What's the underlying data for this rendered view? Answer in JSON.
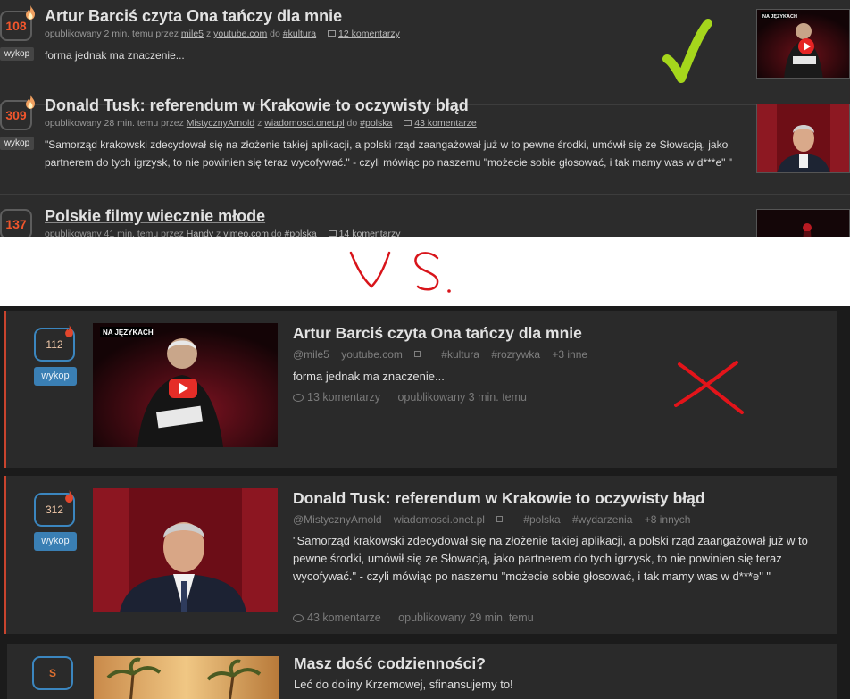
{
  "old": {
    "items": [
      {
        "votes": "108",
        "dig_label": "wykop",
        "title": "Artur Barciś czyta Ona tańczy dla mnie",
        "meta_prefix": "opublikowany 2 min. temu przez",
        "author": "mile5",
        "source_prefix": "z",
        "source": "youtube.com",
        "tag_prefix": "do",
        "tag": "#kultura",
        "comments": "12 komentarzy",
        "description": "forma jednak ma znaczenie...",
        "thumb_caption": "NA JĘZYKACH"
      },
      {
        "votes": "309",
        "dig_label": "wykop",
        "title": "Donald Tusk: referendum w Krakowie to oczywisty błąd",
        "meta_prefix": "opublikowany 28 min. temu przez",
        "author": "MistycznyArnold",
        "source_prefix": "z",
        "source": "wiadomosci.onet.pl",
        "tag_prefix": "do",
        "tag": "#polska",
        "comments": "43 komentarze",
        "description": "\"Samorząd krakowski zdecydował się na złożenie takiej aplikacji, a polski rząd zaangażował już w to pewne środki, umówił się ze Słowacją, jako partnerem do tych igrzysk, to nie powinien się teraz wycofywać.\" - czyli mówiąc po naszemu \"możecie sobie głosować, i tak mamy was w d***e\" \""
      },
      {
        "votes": "137",
        "title": "Polskie filmy wiecznie młode",
        "meta_prefix": "opublikowany 41 min. temu przez",
        "author": "Handy",
        "source_prefix": "z",
        "source": "vimeo.com",
        "tag_prefix": "do",
        "tag": "#polska",
        "comments": "14 komentarzy"
      }
    ]
  },
  "annotations": {
    "vs_label": "V S.",
    "check_color": "#a5d61c",
    "cross_color": "#e3141a",
    "vs_color": "#d8141a"
  },
  "new": {
    "items": [
      {
        "votes": "112",
        "dig_label": "wykop",
        "title": "Artur Barciś czyta Ona tańczy dla mnie",
        "author": "@mile5",
        "source": "youtube.com",
        "tags": [
          "#kultura",
          "#rozrywka"
        ],
        "more": "+3 inne",
        "description": "forma jednak ma znaczenie...",
        "comments": "13 komentarzy",
        "published": "opublikowany 3 min. temu",
        "thumb_caption": "NA JĘZYKACH"
      },
      {
        "votes": "312",
        "dig_label": "wykop",
        "title": "Donald Tusk: referendum w Krakowie to oczywisty błąd",
        "author": "@MistycznyArnold",
        "source": "wiadomosci.onet.pl",
        "tags": [
          "#polska",
          "#wydarzenia"
        ],
        "more": "+8 innych",
        "description": "\"Samorząd krakowski zdecydował się na złożenie takiej aplikacji, a polski rząd zaangażował już w to pewne środki, umówił się ze Słowacją, jako partnerem do tych igrzysk, to nie powinien się teraz wycofywać.\" - czyli mówiąc po naszemu \"możecie sobie głosować, i tak mamy was w d***e\" \"",
        "comments": "43 komentarze",
        "published": "opublikowany 29 min. temu"
      }
    ],
    "ad": {
      "badge": "S",
      "title": "Masz dość codzienności?",
      "description": "Leć do doliny Krzemowej, sfinansujemy to!"
    }
  },
  "colors": {
    "old_vote_text": "#f2562c",
    "new_vote_border": "#3b86bf",
    "new_hot_border": "#c9442e",
    "ad_badge": "#e07030"
  }
}
